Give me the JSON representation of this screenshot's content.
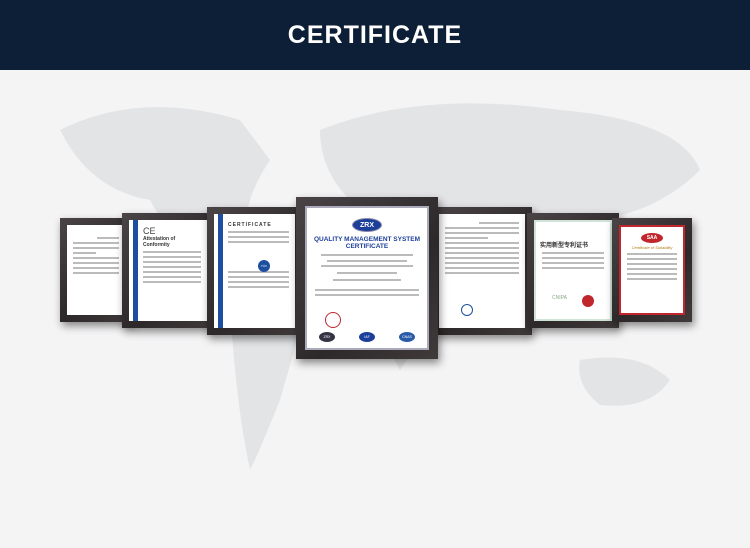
{
  "header": {
    "title": "CERTIFICATE"
  },
  "certificates": [
    {
      "title": "Attestation of Conformity",
      "mark": "CE"
    },
    {
      "title": "CERTIFICATE",
      "mark": "TÜV"
    },
    {
      "logo": "ZRX",
      "title": "QUALITY MANAGEMENT SYSTEM",
      "subtitle": "CERTIFICATE",
      "seals": [
        "ZRX",
        "IAF",
        "CNAS"
      ]
    },
    {
      "title": "实用新型专利证书",
      "mark": "CNIPA"
    },
    {
      "logo": "SAA",
      "title": "Certificate of Suitability"
    }
  ],
  "colors": {
    "header": "#0d1f36",
    "accent_blue": "#1d3f9a",
    "accent_red": "#c0262c"
  }
}
